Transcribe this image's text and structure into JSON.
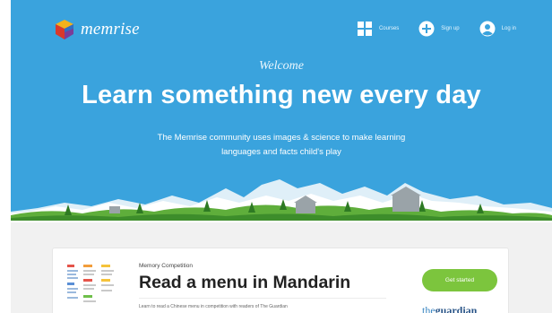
{
  "nav": {
    "logo_text": "memrise",
    "links": [
      {
        "label": "Courses",
        "icon": "courses-grid-icon"
      },
      {
        "label": "Sign up",
        "icon": "sign-up-plus-icon"
      },
      {
        "label": "Log in",
        "icon": "user-icon"
      }
    ]
  },
  "hero": {
    "welcome": "Welcome",
    "headline": "Learn something new every day",
    "subtitle": "The Memrise community uses images & science to make learning languages and facts child's play"
  },
  "card": {
    "kicker": "Memory Competition",
    "title": "Read a menu in Mandarin",
    "description": "Learn to read a Chinese menu in competition with readers of The Guardian",
    "cta_label": "Get started",
    "partner_prefix": "the",
    "partner_name": "guardian"
  },
  "colors": {
    "hero_bg": "#3aa3dd",
    "cta_bg": "#7cc53d",
    "page_bg": "#f1f1f1"
  }
}
